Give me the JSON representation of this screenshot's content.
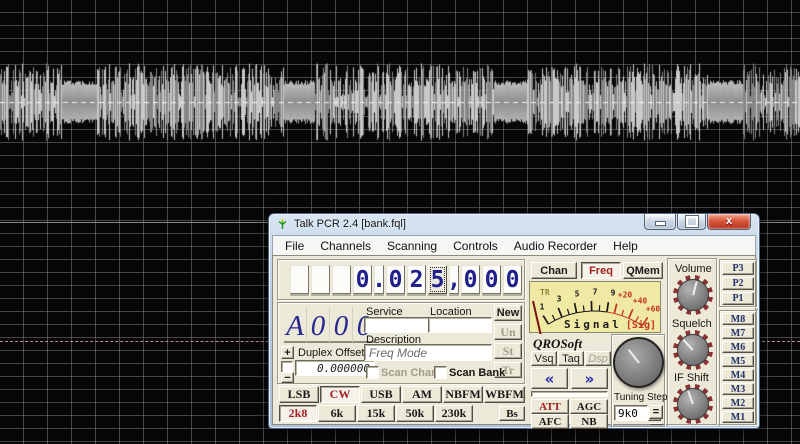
{
  "titlebar": {
    "title": "Talk PCR 2.4 [bank.fql]"
  },
  "menu": {
    "items": [
      "File",
      "Channels",
      "Scanning",
      "Controls",
      "Audio Recorder",
      "Help"
    ]
  },
  "frequency": {
    "cells": [
      "",
      "",
      "",
      "0",
      ".",
      "0",
      "2",
      "5",
      ",",
      "0",
      "0",
      "0"
    ],
    "focused_index": 7
  },
  "channel": {
    "cells": [
      "A",
      "0",
      "0",
      "0"
    ]
  },
  "duplex": {
    "plus": "+",
    "minus": "−",
    "label": "Duplex Offset",
    "value": "0.000000"
  },
  "info": {
    "service_label": "Service",
    "service_value": "",
    "location_label": "Location",
    "location_value": "",
    "description_label": "Description",
    "description_value": "Freq Mode"
  },
  "actions": {
    "new": "New",
    "un": "Un",
    "st": "St",
    "tr": "Tr"
  },
  "scan": {
    "chan": "Scan Chan",
    "bank": "Scan Bank"
  },
  "modes": {
    "items": [
      "LSB",
      "CW",
      "USB",
      "AM",
      "NBFM",
      "WBFM"
    ],
    "active": "CW"
  },
  "filters": {
    "items": [
      "2k8",
      "6k",
      "15k",
      "50k",
      "230k"
    ],
    "bs": "Bs",
    "active": "2k8"
  },
  "tabs": {
    "items": [
      "Chan",
      "Freq",
      "QMem"
    ],
    "active": "Freq"
  },
  "meter": {
    "corner": "TR",
    "scale": [
      "1",
      "3",
      "5",
      "7",
      "9",
      "+20",
      "+40",
      "+60"
    ],
    "label": "Signal",
    "tag": "[Sig]"
  },
  "brand": {
    "logo": "QROSoft"
  },
  "squelch_buttons": {
    "vsq": "Vsq",
    "taq": "Taq",
    "dsp": "Dsp"
  },
  "arrows": {
    "left": "«",
    "right": "»"
  },
  "toggles": {
    "att": "ATT",
    "agc": "AGC",
    "afc": "AFC",
    "nb": "NB"
  },
  "tuning": {
    "label": "Tuning Step",
    "step": "9k0",
    "equals": "="
  },
  "knobs": {
    "volume": "Volume",
    "squelch": "Squelch",
    "if_shift": "IF Shift"
  },
  "memory": {
    "p": [
      "P3",
      "P2",
      "P1"
    ],
    "m": [
      "M8",
      "M7",
      "M6",
      "M5",
      "M4",
      "M3",
      "M2",
      "M1"
    ]
  },
  "colors": {
    "active_text": "#a12020",
    "digit": "#20208c",
    "meter_bg": "#f0e9a4",
    "grid_line": "#8c8c8c"
  }
}
